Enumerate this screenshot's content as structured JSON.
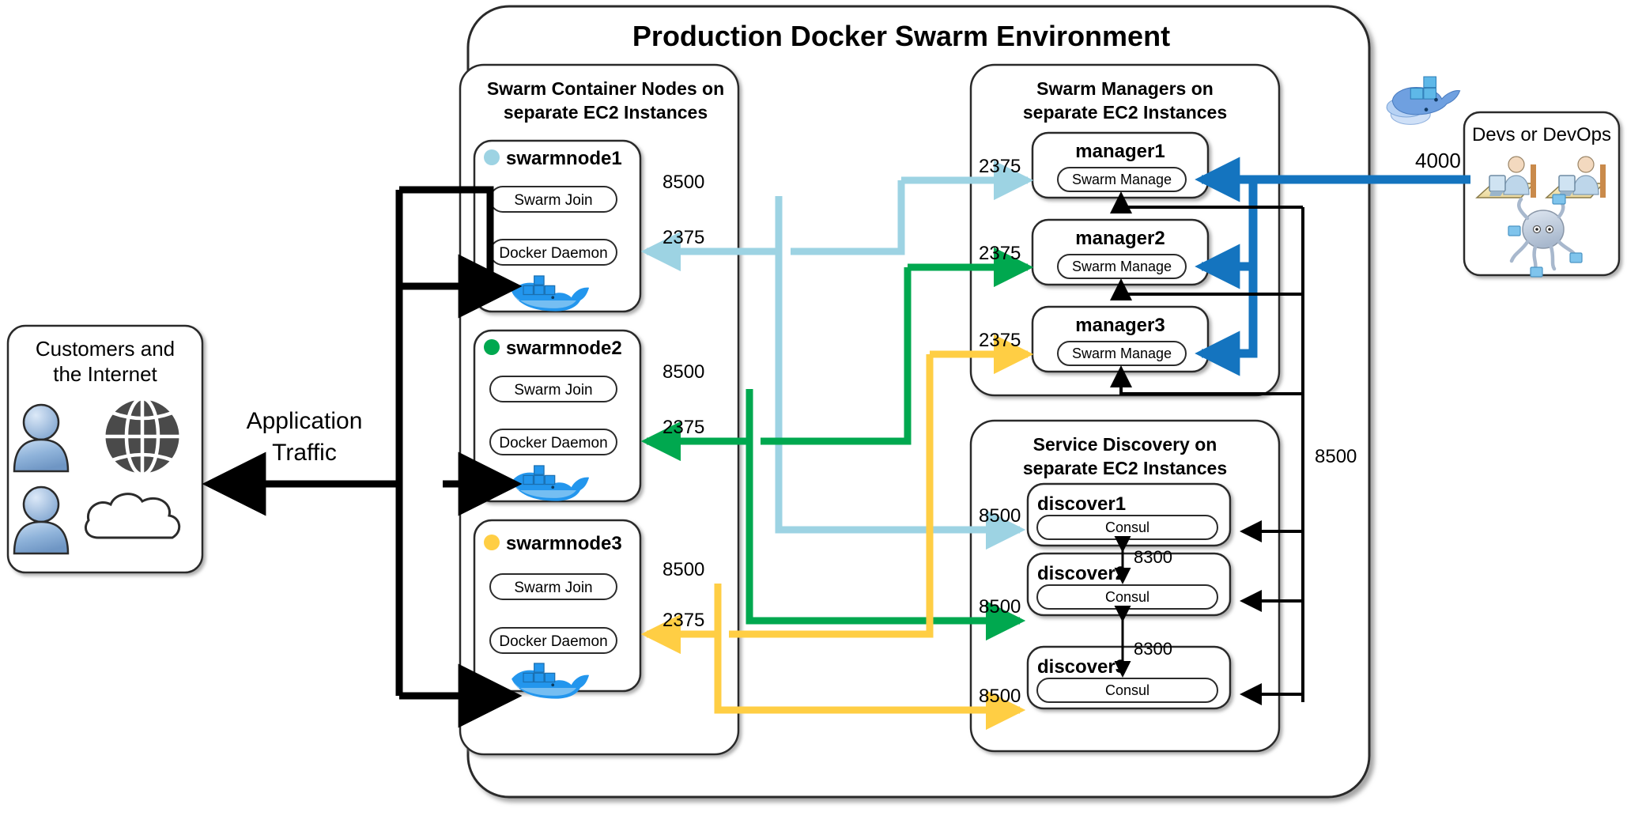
{
  "diagram": {
    "title": "Production Docker Swarm Environment",
    "colors": {
      "node1": "#9DD3E3",
      "node2": "#00A84F",
      "node3": "#FFCE44",
      "devops_arrow": "#1474BF",
      "traffic": "#000000",
      "box_border": "#2b2b2b"
    }
  },
  "panels": {
    "container_nodes": {
      "title_line1": "Swarm Container Nodes on",
      "title_line2": "separate EC2 Instances"
    },
    "managers": {
      "title_line1": "Swarm Managers on",
      "title_line2": "separate EC2 Instances"
    },
    "discovery": {
      "title_line1": "Service Discovery on",
      "title_line2": "separate EC2 Instances"
    }
  },
  "swarm_nodes": [
    {
      "name": "swarmnode1",
      "dot_color": "#9DD3E3",
      "pills": [
        "Swarm Join",
        "Docker Daemon"
      ],
      "ports": {
        "join": "8500",
        "daemon": "2375"
      }
    },
    {
      "name": "swarmnode2",
      "dot_color": "#00A84F",
      "pills": [
        "Swarm Join",
        "Docker Daemon"
      ],
      "ports": {
        "join": "8500",
        "daemon": "2375"
      }
    },
    {
      "name": "swarmnode3",
      "dot_color": "#FFCE44",
      "pills": [
        "Swarm Join",
        "Docker Daemon"
      ],
      "ports": {
        "join": "8500",
        "daemon": "2375"
      }
    }
  ],
  "managers": [
    {
      "name": "manager1",
      "pill": "Swarm Manage",
      "port": "2375"
    },
    {
      "name": "manager2",
      "pill": "Swarm Manage",
      "port": "2375"
    },
    {
      "name": "manager3",
      "pill": "Swarm Manage",
      "port": "2375"
    }
  ],
  "discovery_nodes": [
    {
      "name": "discover1",
      "pill": "Consul",
      "port": "8500"
    },
    {
      "name": "discover2",
      "pill": "Consul",
      "port": "8500"
    },
    {
      "name": "discover3",
      "pill": "Consul",
      "port": "8500"
    }
  ],
  "gossip_ports": [
    "8300",
    "8300"
  ],
  "customers": {
    "title_line1": "Customers and",
    "title_line2": "the Internet"
  },
  "traffic": {
    "label_line1": "Application",
    "label_line2": "Traffic"
  },
  "devops": {
    "title": "Devs or DevOps",
    "port": "4000"
  },
  "manager_to_consul_port": "8500"
}
